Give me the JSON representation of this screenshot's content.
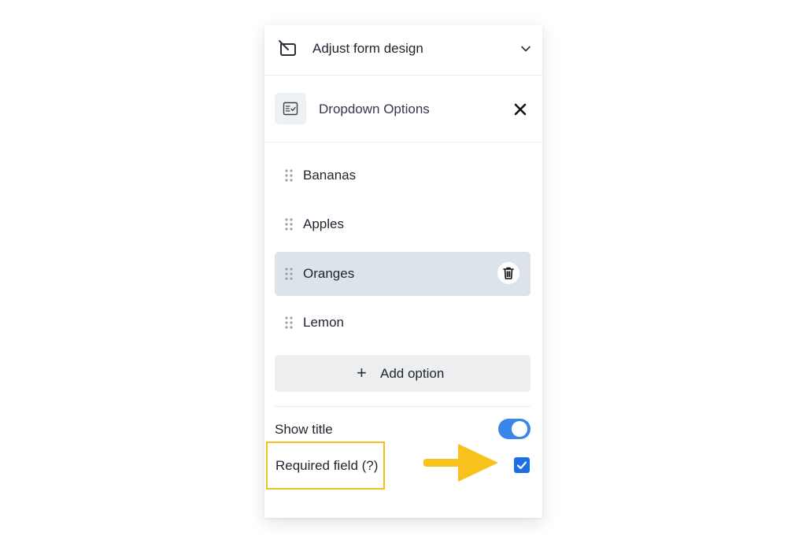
{
  "header": {
    "title": "Adjust form design",
    "icon": "slash-rectangle-icon"
  },
  "section": {
    "title": "Dropdown Options",
    "icon": "list-check-icon"
  },
  "options": [
    {
      "label": "Bananas",
      "selected": false
    },
    {
      "label": "Apples",
      "selected": false
    },
    {
      "label": "Oranges",
      "selected": true
    },
    {
      "label": "Lemon",
      "selected": false
    }
  ],
  "add_option": {
    "icon": "+",
    "label": "Add option"
  },
  "settings": {
    "show_title": {
      "label": "Show title",
      "on": true
    },
    "required": {
      "label": "Required field (?)",
      "checked": true
    }
  },
  "colors": {
    "accent": "#3a86e8",
    "checkbox": "#1e6fe3",
    "selected_row": "#dde3ea",
    "highlight": "#f3c21a"
  }
}
